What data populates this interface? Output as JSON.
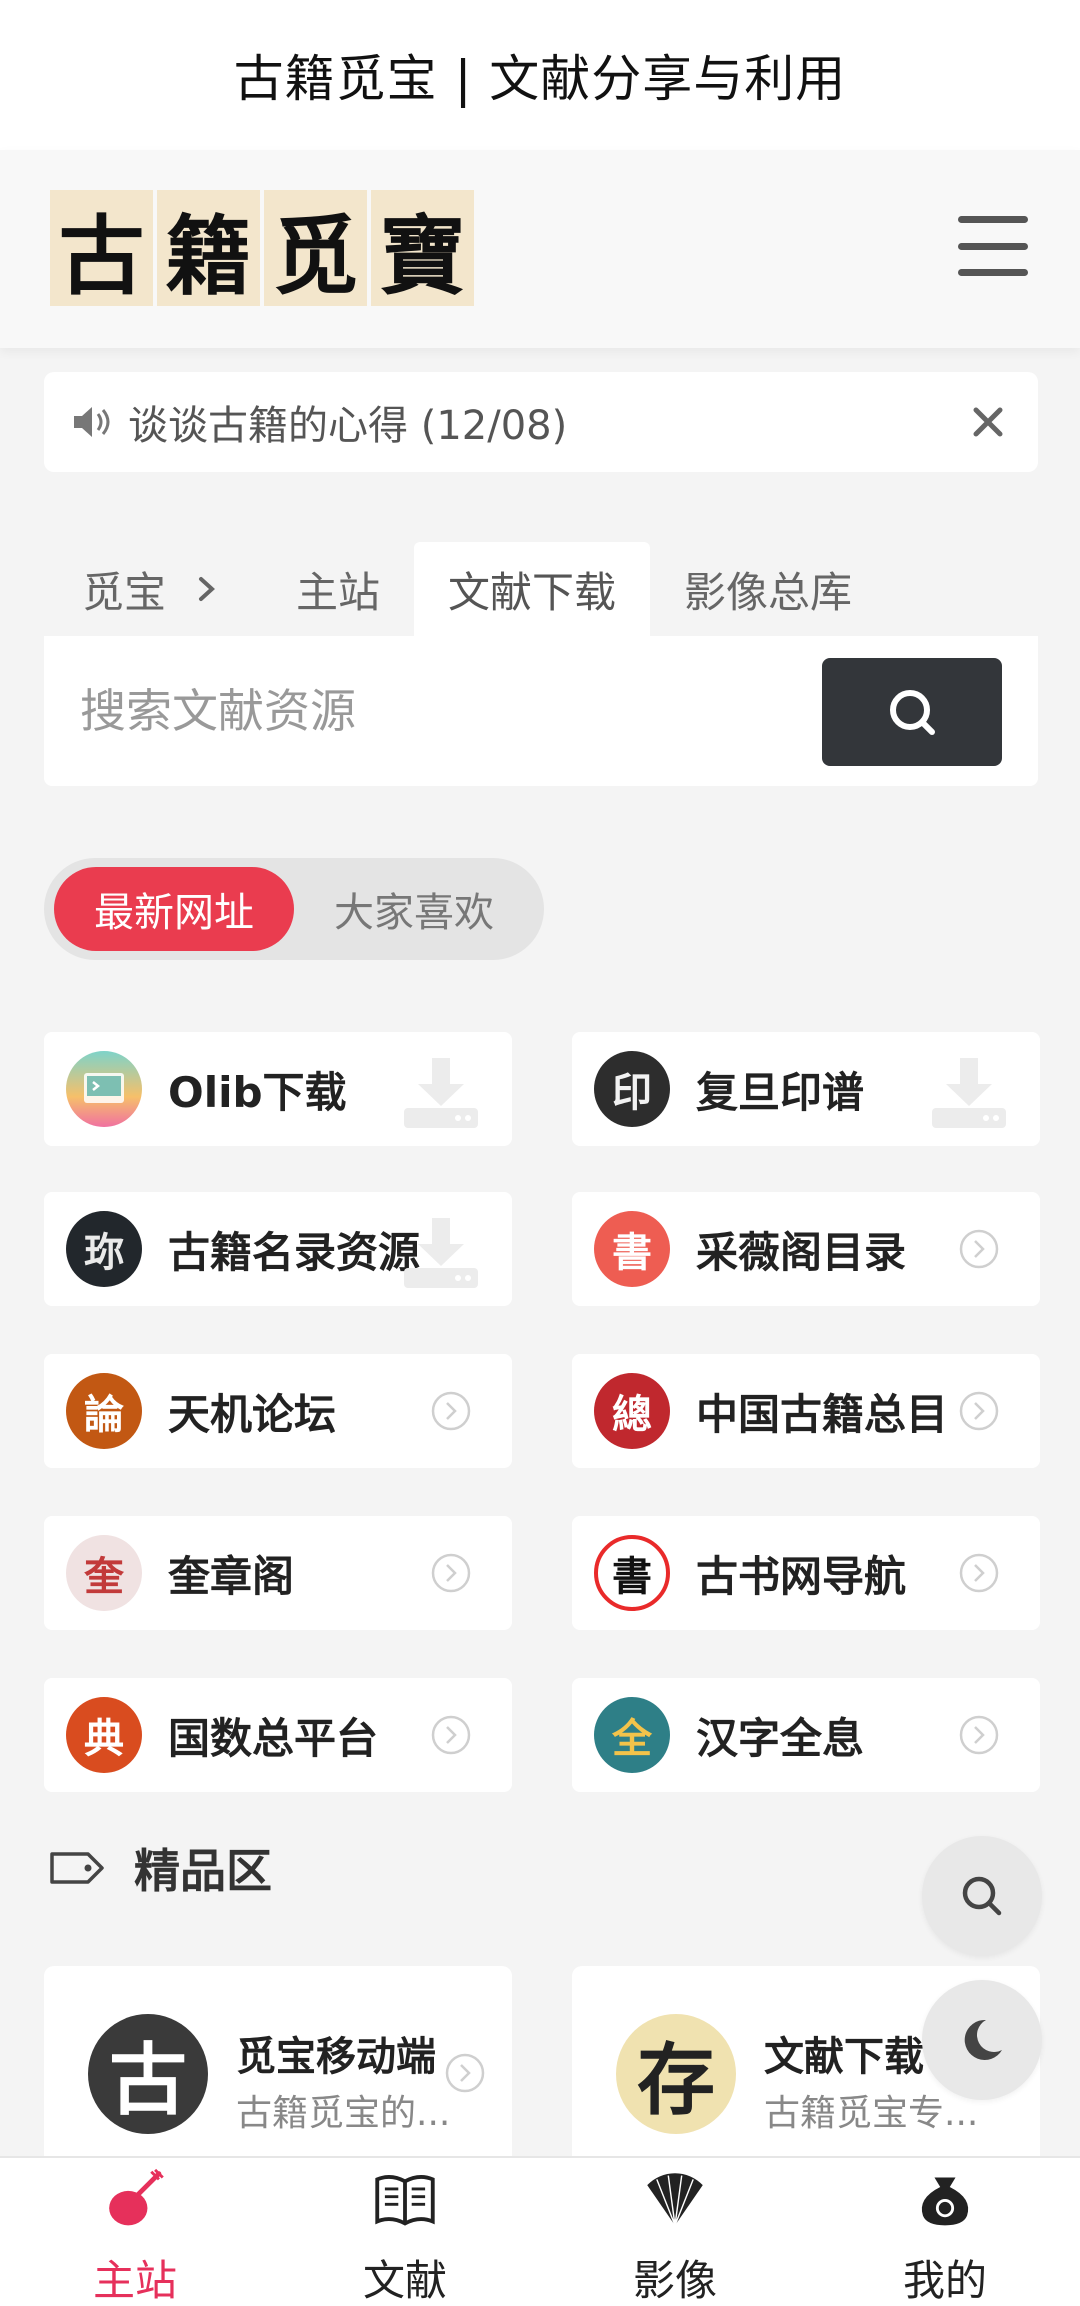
{
  "page": {
    "title": "古籍觅宝 | 文献分享与利用"
  },
  "header": {
    "logo_chars": [
      "古",
      "籍",
      "觅",
      "寶"
    ]
  },
  "notice": {
    "text": "谈谈古籍的心得 (12/08)"
  },
  "tabs": {
    "root": "觅宝",
    "items": [
      "主站",
      "文献下载",
      "影像总库"
    ],
    "active": "文献下载"
  },
  "search": {
    "placeholder": "搜索文献资源",
    "value": ""
  },
  "toggle": {
    "active_label": "最新网址",
    "inactive_label": "大家喜欢"
  },
  "links": [
    {
      "label": "Olib下载",
      "icon": "olib-icon",
      "icon_color": "#7ed3c9",
      "icon_char": "",
      "trail": "download-icon"
    },
    {
      "label": "复旦印谱",
      "icon": "yin-seal-icon",
      "icon_color": "#2d2d2d",
      "icon_char": "印",
      "trail": "download-icon"
    },
    {
      "label": "古籍名录资源",
      "icon": "mi-seal-icon",
      "icon_color": "#22272c",
      "icon_char": "珎",
      "trail": "download-icon"
    },
    {
      "label": "采薇阁目录",
      "icon": "caiwei-seal-icon",
      "icon_color": "#ee5d52",
      "icon_char": "書",
      "trail": "chevron-right-icon"
    },
    {
      "label": "天机论坛",
      "icon": "tianji-seal-icon",
      "icon_color": "#c25813",
      "icon_char": "論",
      "trail": "chevron-right-icon"
    },
    {
      "label": "中国古籍总目",
      "icon": "zongmu-seal-icon",
      "icon_color": "#c0282e",
      "icon_char": "總",
      "trail": "chevron-right-icon"
    },
    {
      "label": "奎章阁",
      "icon": "kuizhang-seal-icon",
      "icon_color": "#f0e2e2",
      "icon_char": "奎",
      "trail": "chevron-right-icon"
    },
    {
      "label": "古书网导航",
      "icon": "gushu-nav-icon",
      "icon_color": "#e92a2a",
      "icon_char": "書",
      "trail": "chevron-right-icon"
    },
    {
      "label": "国数总平台",
      "icon": "guoshu-seal-icon",
      "icon_color": "#d94c1f",
      "icon_char": "典",
      "trail": "chevron-right-icon"
    },
    {
      "label": "汉字全息",
      "icon": "hanzi-seal-icon",
      "icon_color": "#2e7f87",
      "icon_char": "全",
      "trail": "chevron-right-icon"
    }
  ],
  "featured": {
    "section_title": "精品区",
    "items": [
      {
        "title": "觅宝移动端",
        "desc": "古籍觅宝的...",
        "icon_char": "古",
        "icon_bg": "#3a3a3a",
        "icon_fg": "#ffffff"
      },
      {
        "title": "文献下载",
        "desc": "古籍觅宝专...",
        "icon_char": "存",
        "icon_bg": "#f0e2b0",
        "icon_fg": "#222222"
      }
    ]
  },
  "bottom_nav": {
    "items": [
      {
        "label": "主站",
        "icon": "pipa-icon",
        "active": true
      },
      {
        "label": "文献",
        "icon": "book-icon",
        "active": false
      },
      {
        "label": "影像",
        "icon": "fan-icon",
        "active": false
      },
      {
        "label": "我的",
        "icon": "money-bag-icon",
        "active": false
      }
    ]
  },
  "colors": {
    "accent": "#ea3c4f",
    "nav_active": "#e6305b",
    "search_button": "#33363a"
  }
}
